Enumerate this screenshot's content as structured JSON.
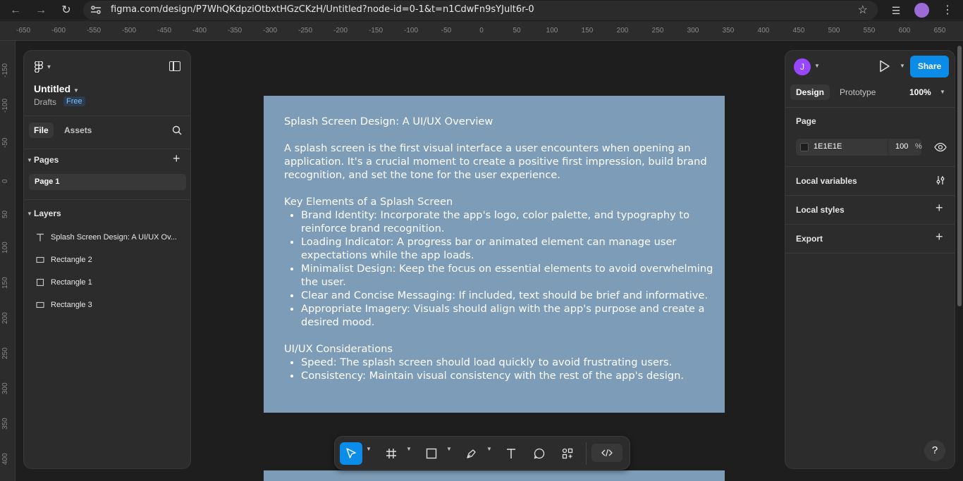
{
  "browser": {
    "url": "figma.com/design/P7WhQKdpziOtbxtHGzCKzH/Untitled?node-id=0-1&t=n1CdwFn9sYJult6r-0",
    "back_icon": "arrow-left",
    "forward_icon": "arrow-right",
    "reload_icon": "reload",
    "star_icon": "star",
    "menu_icon": "kebab-menu"
  },
  "rulers": {
    "top": [
      "-650",
      "-600",
      "-550",
      "-500",
      "-450",
      "-400",
      "-350",
      "-300",
      "-250",
      "-200",
      "-150",
      "-100",
      "-50",
      "0",
      "50",
      "100",
      "150",
      "200",
      "250",
      "300",
      "350",
      "400",
      "450",
      "500",
      "550",
      "600",
      "650"
    ],
    "left": [
      "-150",
      "-100",
      "-50",
      "0",
      "50",
      "100",
      "150",
      "200",
      "250",
      "300",
      "350",
      "400"
    ]
  },
  "left_panel": {
    "file_title": "Untitled",
    "drafts_label": "Drafts",
    "plan_badge": "Free",
    "tabs": {
      "file": "File",
      "assets": "Assets"
    },
    "pages_heading": "Pages",
    "pages": [
      "Page 1"
    ],
    "layers_heading": "Layers",
    "layers": [
      {
        "type": "text",
        "name": "Splash Screen Design: A UI/UX Ov..."
      },
      {
        "type": "rectangle",
        "name": "Rectangle 2"
      },
      {
        "type": "rectangle",
        "name": "Rectangle 1"
      },
      {
        "type": "rectangle",
        "name": "Rectangle 3"
      }
    ]
  },
  "canvas": {
    "frame_color": "#7d9cb7",
    "text": {
      "title": "Splash Screen Design: A UI/UX Overview",
      "intro": "A splash screen is the first visual interface a user encounters when opening an application. It's a crucial moment to create a positive first impression, build brand recognition, and set the tone for the user experience.",
      "section1_heading": "Key Elements of a Splash Screen",
      "section1_items": [
        "Brand Identity: Incorporate the app's logo, color palette, and typography to reinforce brand recognition.",
        "Loading Indicator: A progress bar or animated element can manage user expectations while the app loads.",
        "Minimalist Design: Keep the focus on essential elements to avoid overwhelming the user.",
        "Clear and Concise Messaging: If included, text should be brief and informative.",
        "Appropriate Imagery: Visuals should align with the app's purpose and create a desired mood."
      ],
      "section2_heading": "UI/UX Considerations",
      "section2_items": [
        "Speed: The splash screen should load quickly to avoid frustrating users.",
        "Consistency: Maintain visual consistency with the rest of the app's design."
      ]
    }
  },
  "toolbar": {
    "tools": [
      "move-tool",
      "frame-tool",
      "shape-tool",
      "pen-tool",
      "text-tool",
      "comment-tool",
      "actions-tool"
    ],
    "dev_mode_icon": "code-brackets",
    "accent": "#0c8ce9"
  },
  "right_panel": {
    "avatar_initial": "J",
    "avatar_color": "#9747ff",
    "share_label": "Share",
    "tabs": {
      "design": "Design",
      "prototype": "Prototype"
    },
    "zoom": "100%",
    "page_heading": "Page",
    "page_bg_hex": "1E1E1E",
    "page_bg_opacity": "100",
    "percent_sign": "%",
    "local_variables": "Local variables",
    "local_styles": "Local styles",
    "export": "Export",
    "help": "?"
  }
}
